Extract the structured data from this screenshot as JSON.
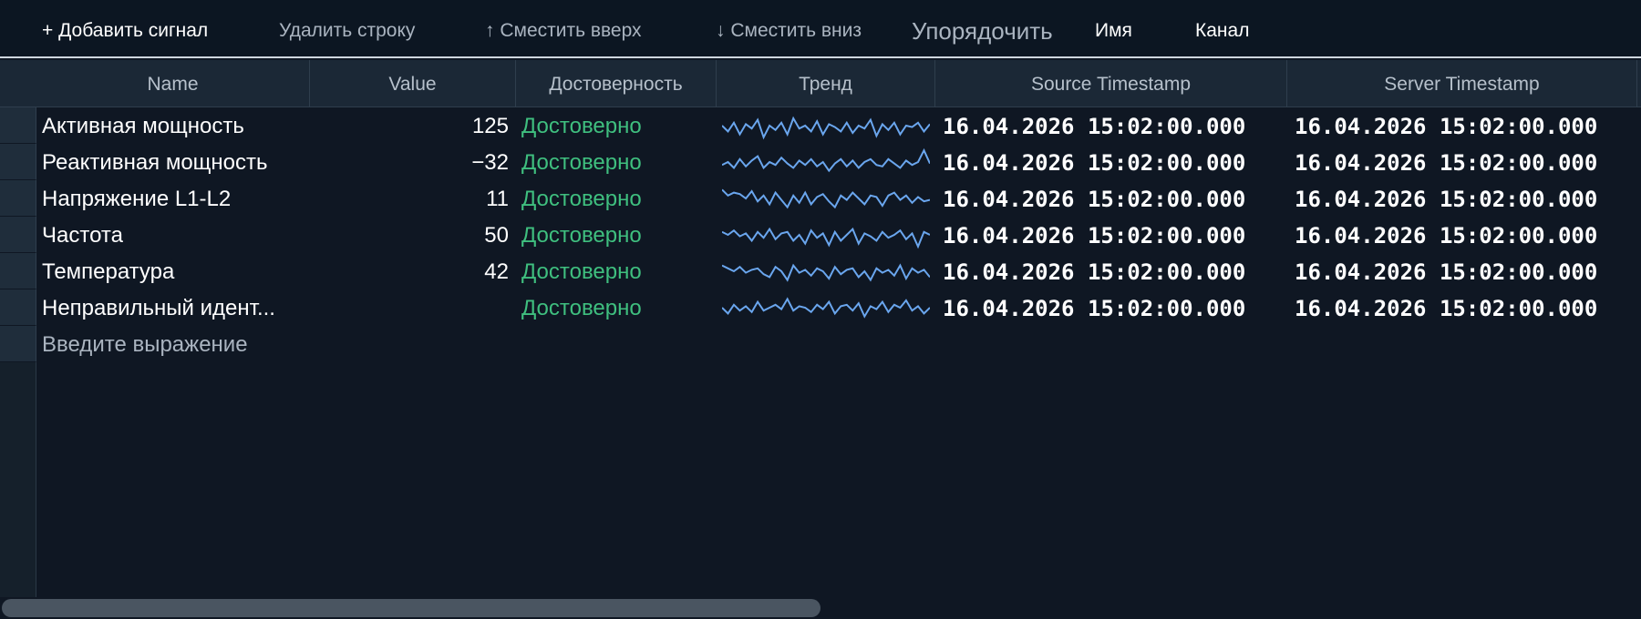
{
  "toolbar": {
    "add_signal": "+ Добавить сигнал",
    "delete_row": "Удалить строку",
    "move_up": "↑ Сместить вверх",
    "move_down": "↓ Сместить вниз",
    "sort": "Упорядочить",
    "name": "Имя",
    "channel": "Канал"
  },
  "columns": [
    "Name",
    "Value",
    "Достоверность",
    "Тренд",
    "Source Timestamp",
    "Server Timestamp"
  ],
  "rows": [
    {
      "name": "Активная мощность",
      "value": "125",
      "quality": "Достоверно",
      "source_ts": "16.04.2026 15:02:00.000",
      "server_ts": "16.04.2026 15:02:00.000",
      "trend": [
        0.5,
        0.3,
        0.6,
        0.2,
        0.55,
        0.4,
        0.7,
        0.1,
        0.5,
        0.35,
        0.6,
        0.2,
        0.75,
        0.4,
        0.5,
        0.3,
        0.65,
        0.2,
        0.55,
        0.45,
        0.3,
        0.6,
        0.25,
        0.5,
        0.4,
        0.7,
        0.15,
        0.55,
        0.35,
        0.6,
        0.2,
        0.5,
        0.45,
        0.6,
        0.3,
        0.55
      ]
    },
    {
      "name": "Реактивная мощность",
      "value": "−32",
      "quality": "Достоверно",
      "source_ts": "16.04.2026 15:02:00.000",
      "server_ts": "16.04.2026 15:02:00.000",
      "trend": [
        0.4,
        0.5,
        0.3,
        0.6,
        0.35,
        0.55,
        0.7,
        0.3,
        0.5,
        0.4,
        0.65,
        0.45,
        0.3,
        0.55,
        0.4,
        0.6,
        0.35,
        0.5,
        0.2,
        0.45,
        0.6,
        0.35,
        0.55,
        0.3,
        0.5,
        0.6,
        0.4,
        0.35,
        0.6,
        0.45,
        0.3,
        0.55,
        0.4,
        0.5,
        0.9,
        0.45
      ]
    },
    {
      "name": "Напряжение L1-L2",
      "value": "11",
      "quality": "Достоверно",
      "source_ts": "16.04.2026 15:02:00.000",
      "server_ts": "16.04.2026 15:02:00.000",
      "trend": [
        0.8,
        0.6,
        0.7,
        0.65,
        0.5,
        0.75,
        0.4,
        0.6,
        0.3,
        0.7,
        0.45,
        0.2,
        0.6,
        0.35,
        0.7,
        0.3,
        0.55,
        0.65,
        0.4,
        0.2,
        0.6,
        0.45,
        0.7,
        0.5,
        0.3,
        0.6,
        0.55,
        0.25,
        0.6,
        0.7,
        0.45,
        0.6,
        0.35,
        0.55,
        0.4,
        0.45
      ]
    },
    {
      "name": "Частота",
      "value": "50",
      "quality": "Достоверно",
      "source_ts": "16.04.2026 15:02:00.000",
      "server_ts": "16.04.2026 15:02:00.000",
      "trend": [
        0.6,
        0.5,
        0.65,
        0.45,
        0.55,
        0.3,
        0.6,
        0.4,
        0.7,
        0.35,
        0.55,
        0.6,
        0.3,
        0.5,
        0.2,
        0.65,
        0.4,
        0.55,
        0.15,
        0.6,
        0.3,
        0.5,
        0.7,
        0.2,
        0.55,
        0.45,
        0.3,
        0.6,
        0.4,
        0.5,
        0.65,
        0.35,
        0.55,
        0.1,
        0.6,
        0.5
      ]
    },
    {
      "name": "Температура",
      "value": "42",
      "quality": "Достоверно",
      "source_ts": "16.04.2026 15:02:00.000",
      "server_ts": "16.04.2026 15:02:00.000",
      "trend": [
        0.7,
        0.6,
        0.5,
        0.65,
        0.45,
        0.55,
        0.6,
        0.4,
        0.3,
        0.65,
        0.5,
        0.2,
        0.7,
        0.45,
        0.55,
        0.35,
        0.6,
        0.5,
        0.25,
        0.65,
        0.4,
        0.55,
        0.6,
        0.3,
        0.5,
        0.2,
        0.6,
        0.45,
        0.55,
        0.35,
        0.7,
        0.25,
        0.6,
        0.45,
        0.55,
        0.3
      ]
    },
    {
      "name": "Неправильный идент...",
      "value": "",
      "quality": "Достоверно",
      "source_ts": "16.04.2026 15:02:00.000",
      "server_ts": "16.04.2026 15:02:00.000",
      "trend": [
        0.5,
        0.3,
        0.6,
        0.4,
        0.55,
        0.35,
        0.7,
        0.4,
        0.5,
        0.6,
        0.45,
        0.8,
        0.4,
        0.55,
        0.5,
        0.35,
        0.6,
        0.45,
        0.7,
        0.3,
        0.55,
        0.6,
        0.4,
        0.65,
        0.2,
        0.55,
        0.45,
        0.7,
        0.35,
        0.6,
        0.5,
        0.75,
        0.4,
        0.55,
        0.3,
        0.5
      ]
    }
  ],
  "placeholder": "Введите выражение",
  "colors": {
    "quality_good": "#3fbf7f",
    "trend": "#6aa6ee",
    "background": "#0f1723",
    "header": "#1b2836"
  }
}
